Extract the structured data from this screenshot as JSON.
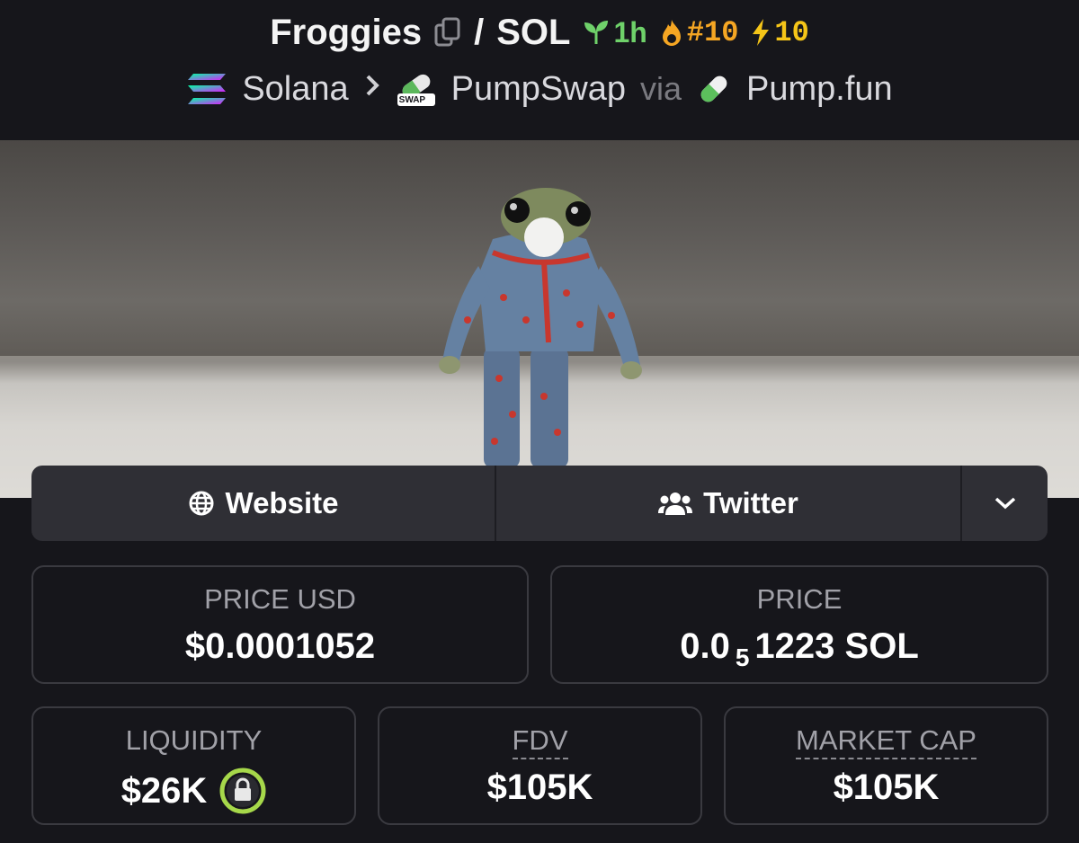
{
  "header": {
    "base_token": "Froggies",
    "separator": "/",
    "quote_token": "SOL",
    "age": "1h",
    "trending_rank": "#10",
    "boosts": "10"
  },
  "breadcrumb": {
    "chain": "Solana",
    "dex": "PumpSwap",
    "dex_badge": "SWAP",
    "via": "via",
    "launchpad": "Pump.fun"
  },
  "links": {
    "website": "Website",
    "twitter": "Twitter"
  },
  "stats": {
    "price_usd_label": "PRICE USD",
    "price_usd": "$0.0001052",
    "price_label": "PRICE",
    "price_prefix": "0.0",
    "price_zeros": "5",
    "price_digits": "1223 SOL",
    "liquidity_label": "LIQUIDITY",
    "liquidity": "$26K",
    "fdv_label": "FDV",
    "fdv": "$105K",
    "mcap_label": "MARKET CAP",
    "mcap": "$105K"
  },
  "colors": {
    "background": "#16161b",
    "age_green": "#6fd16a",
    "trend_orange": "#f5a623",
    "boost_yellow": "#f5c518",
    "lock_green": "#a6d84a"
  },
  "icons": [
    "copy-icon",
    "sprout-icon",
    "flame-icon",
    "lightning-icon",
    "solana-logo-icon",
    "chevron-right-icon",
    "pumpswap-logo-icon",
    "pill-icon",
    "globe-icon",
    "users-icon",
    "chevron-down-icon",
    "lock-icon"
  ]
}
